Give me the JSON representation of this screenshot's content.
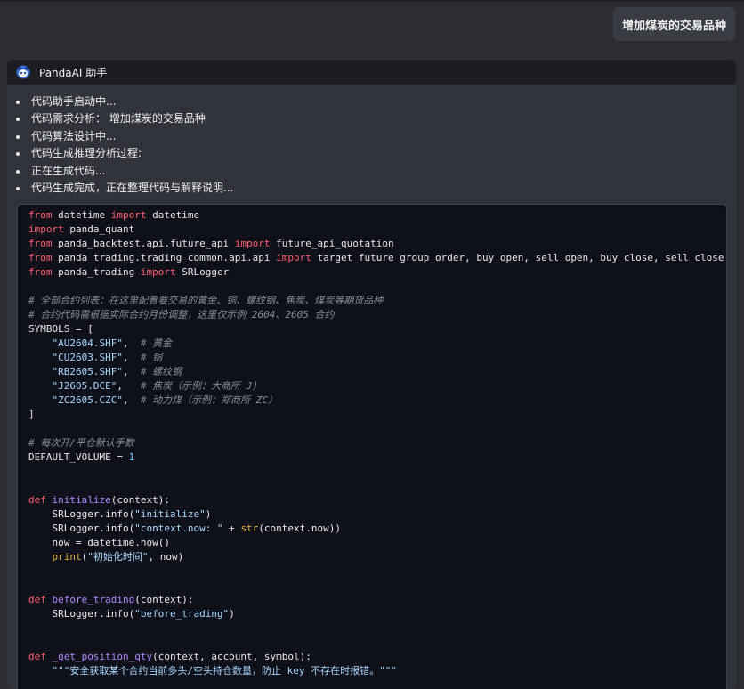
{
  "user_message": "增加煤炭的交易品种",
  "assistant": {
    "name": "PandaAI 助手",
    "logo_icon": "panda-logo-icon",
    "status_items": [
      "代码助手启动中...",
      "代码需求分析： 增加煤炭的交易品种",
      "代码算法设计中...",
      "代码生成推理分析过程:",
      "正在生成代码...",
      "代码生成完成，正在整理代码与解释说明..."
    ]
  },
  "code": {
    "language": "python",
    "lines": [
      [
        [
          "kw",
          "from"
        ],
        [
          "tx",
          " datetime "
        ],
        [
          "kw",
          "import"
        ],
        [
          "tx",
          " datetime"
        ]
      ],
      [
        [
          "kw",
          "import"
        ],
        [
          "tx",
          " panda_quant"
        ]
      ],
      [
        [
          "kw",
          "from"
        ],
        [
          "tx",
          " panda_backtest.api.future_api "
        ],
        [
          "kw",
          "import"
        ],
        [
          "tx",
          " future_api_quotation"
        ]
      ],
      [
        [
          "kw",
          "from"
        ],
        [
          "tx",
          " panda_trading.trading_common.api.api "
        ],
        [
          "kw",
          "import"
        ],
        [
          "tx",
          " target_future_group_order, buy_open, sell_open, buy_close, sell_close"
        ]
      ],
      [
        [
          "kw",
          "from"
        ],
        [
          "tx",
          " panda_trading "
        ],
        [
          "kw",
          "import"
        ],
        [
          "tx",
          " SRLogger"
        ]
      ],
      [],
      [
        [
          "cm",
          "# 全部合约列表：在这里配置要交易的黄金、铜、螺纹钢、焦炭、煤炭等期货品种"
        ]
      ],
      [
        [
          "cm",
          "# 合约代码需根据实际合约月份调整，这里仅示例 2604、2605 合约"
        ]
      ],
      [
        [
          "tx",
          "SYMBOLS = ["
        ]
      ],
      [
        [
          "tx",
          "    "
        ],
        [
          "str",
          "\"AU2604.SHF\""
        ],
        [
          "tx",
          ",  "
        ],
        [
          "cm",
          "# 黄金"
        ]
      ],
      [
        [
          "tx",
          "    "
        ],
        [
          "str",
          "\"CU2603.SHF\""
        ],
        [
          "tx",
          ",  "
        ],
        [
          "cm",
          "# 铜"
        ]
      ],
      [
        [
          "tx",
          "    "
        ],
        [
          "str",
          "\"RB2605.SHF\""
        ],
        [
          "tx",
          ",  "
        ],
        [
          "cm",
          "# 螺纹钢"
        ]
      ],
      [
        [
          "tx",
          "    "
        ],
        [
          "str",
          "\"J2605.DCE\""
        ],
        [
          "tx",
          ",   "
        ],
        [
          "cm",
          "# 焦炭（示例：大商所 J）"
        ]
      ],
      [
        [
          "tx",
          "    "
        ],
        [
          "str",
          "\"ZC2605.CZC\""
        ],
        [
          "tx",
          ",  "
        ],
        [
          "cm",
          "# 动力煤（示例：郑商所 ZC）"
        ]
      ],
      [
        [
          "tx",
          "]"
        ]
      ],
      [],
      [
        [
          "cm",
          "# 每次开/平仓默认手数"
        ]
      ],
      [
        [
          "tx",
          "DEFAULT_VOLUME = "
        ],
        [
          "num",
          "1"
        ]
      ],
      [],
      [],
      [
        [
          "kw",
          "def"
        ],
        [
          "tx",
          " "
        ],
        [
          "fn",
          "initialize"
        ],
        [
          "tx",
          "(context):"
        ]
      ],
      [
        [
          "tx",
          "    SRLogger.info("
        ],
        [
          "str",
          "\"initialize\""
        ],
        [
          "tx",
          ")"
        ]
      ],
      [
        [
          "tx",
          "    SRLogger.info("
        ],
        [
          "str",
          "\"context.now: \""
        ],
        [
          "tx",
          " + "
        ],
        [
          "bi",
          "str"
        ],
        [
          "tx",
          "(context.now))"
        ]
      ],
      [
        [
          "tx",
          "    now = datetime.now()"
        ]
      ],
      [
        [
          "tx",
          "    "
        ],
        [
          "bi",
          "print"
        ],
        [
          "tx",
          "("
        ],
        [
          "str",
          "\"初始化时间\""
        ],
        [
          "tx",
          ", now)"
        ]
      ],
      [],
      [],
      [
        [
          "kw",
          "def"
        ],
        [
          "tx",
          " "
        ],
        [
          "fn",
          "before_trading"
        ],
        [
          "tx",
          "(context):"
        ]
      ],
      [
        [
          "tx",
          "    SRLogger.info("
        ],
        [
          "str",
          "\"before_trading\""
        ],
        [
          "tx",
          ")"
        ]
      ],
      [],
      [],
      [
        [
          "kw",
          "def"
        ],
        [
          "tx",
          " "
        ],
        [
          "fn",
          "_get_position_qty"
        ],
        [
          "tx",
          "(context, account, symbol):"
        ]
      ],
      [
        [
          "tx",
          "    "
        ],
        [
          "str",
          "\"\"\"安全获取某个合约当前多头/空头持仓数量，防止 key 不存在时报错。\"\"\""
        ]
      ]
    ]
  }
}
